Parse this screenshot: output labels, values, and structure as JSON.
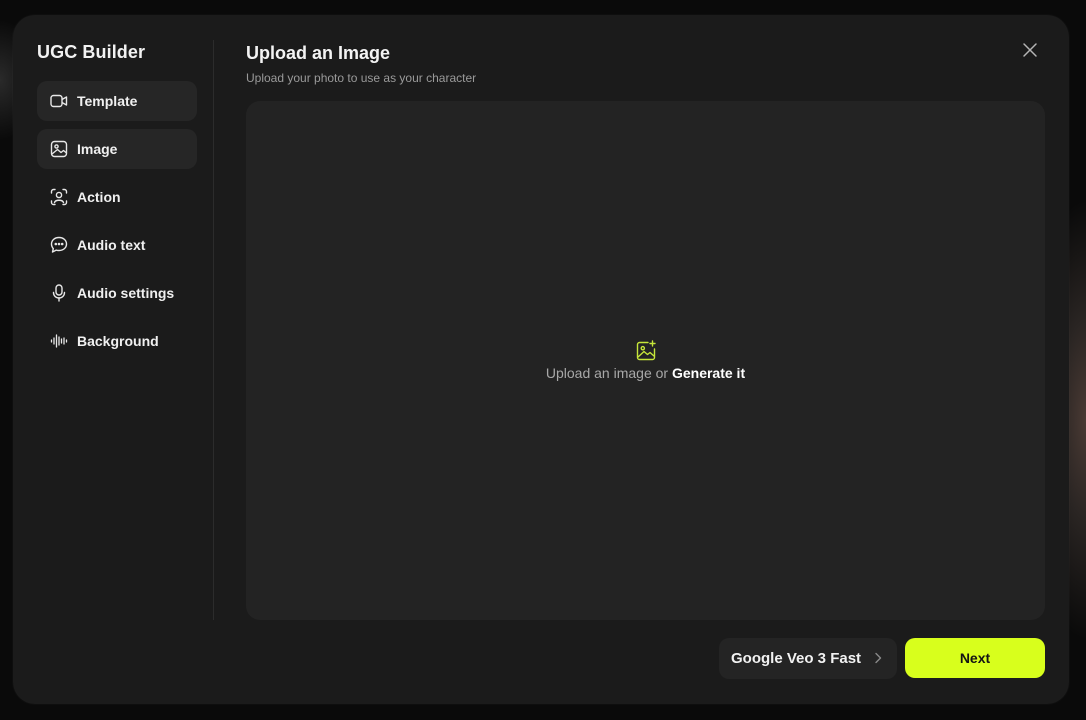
{
  "app": {
    "title": "UGC Builder"
  },
  "sidebar": {
    "items": [
      {
        "label": "Template",
        "icon": "video-camera-icon",
        "filled": true
      },
      {
        "label": "Image",
        "icon": "image-icon",
        "filled": true,
        "active": true
      },
      {
        "label": "Action",
        "icon": "person-frame-icon"
      },
      {
        "label": "Audio text",
        "icon": "chat-bubble-icon"
      },
      {
        "label": "Audio settings",
        "icon": "microphone-icon"
      },
      {
        "label": "Background",
        "icon": "sound-wave-icon"
      }
    ]
  },
  "header": {
    "title": "Upload an Image",
    "subtitle": "Upload your photo to use as your character"
  },
  "dropzone": {
    "icon": "image-add-icon",
    "text_prefix": "Upload an image or ",
    "generate_label": "Generate it"
  },
  "footer": {
    "model_label": "Google Veo 3 Fast",
    "next_label": "Next"
  },
  "colors": {
    "accent": "#d8ff1c",
    "modal_bg": "#1b1b1b",
    "panel_bg": "#232323",
    "icon_accent": "#c6e63a"
  }
}
